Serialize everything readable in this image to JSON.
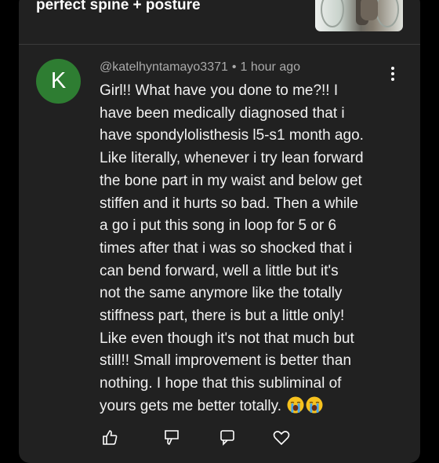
{
  "video": {
    "title": "perfect spine + posture",
    "thumbnail_icon": "video-thumbnail"
  },
  "comment": {
    "avatar_letter": "K",
    "avatar_color": "#2e7d32",
    "author": "@katelhyntamayo3371",
    "separator": "•",
    "time": "1 hour ago",
    "more_icon": "more-vertical-icon",
    "lines": [
      "Girl!! What have you done to me?!! I",
      "have been medically diagnosed that i",
      "have spondylolisthesis l5-s1 month ago.",
      "Like literally, whenever i try lean forward",
      "the bone part in my waist and below get",
      "stiffen and it hurts so bad. Then a while",
      "a go i put this song in loop for 5 or 6",
      "times after that i was so shocked that i",
      "can bend forward, well a little but it's",
      "not the same anymore like the totally",
      "stiffness part, there is but a little only!",
      "Like even though it's not that much but",
      "still!! Small improvement is better than",
      "nothing. I hope that this subliminal of",
      "yours gets me better totally."
    ],
    "end_emoji": "loudly-crying-face-icon x2"
  },
  "actions": {
    "icons": [
      "like-icon",
      "dislike-icon",
      "reply-icon",
      "heart-icon"
    ]
  },
  "colors": {
    "background": "#000000",
    "panel": "#212121",
    "text": "#f1f1f1",
    "meta": "#aaaaaa"
  }
}
